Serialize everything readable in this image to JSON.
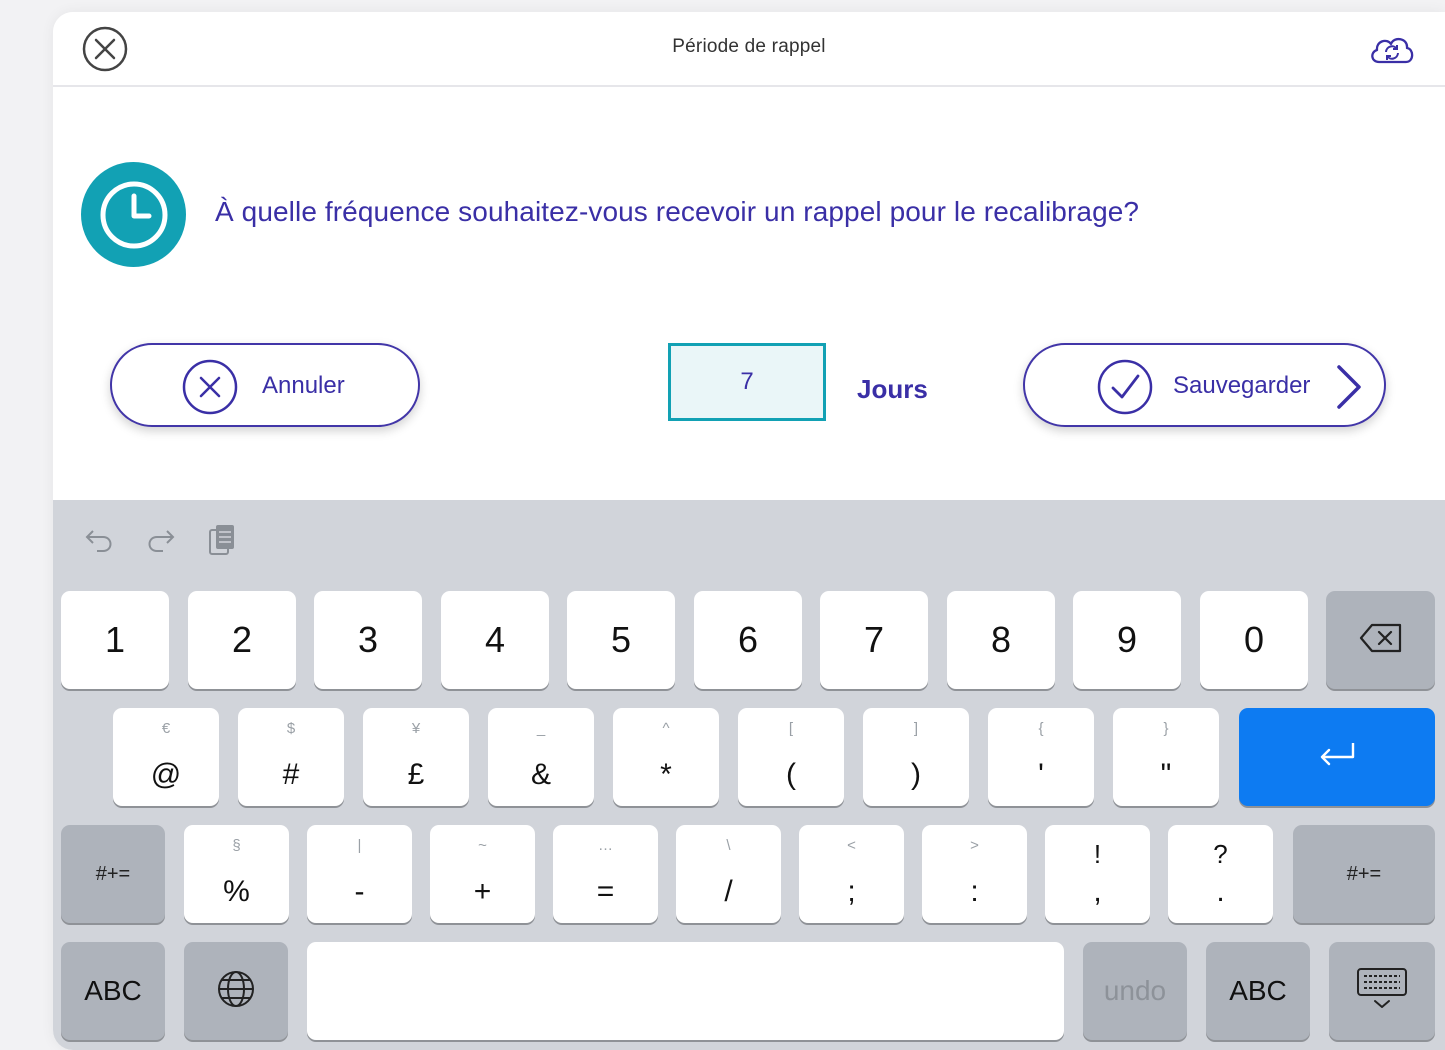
{
  "header": {
    "title": "Période de rappel",
    "close_icon": "close-circle-icon",
    "sync_icon": "cloud-sync-icon"
  },
  "prompt": {
    "icon": "clock-icon",
    "question": "À quelle fréquence souhaitez-vous recevoir un rappel pour le recalibrage?"
  },
  "actions": {
    "cancel_label": "Annuler",
    "save_label": "Sauvegarder"
  },
  "reminder": {
    "value": "7",
    "unit": "Jours"
  },
  "colors": {
    "accent": "#3a2fa6",
    "teal": "#12a1b4",
    "keyboard_bg": "#d1d4da",
    "return_key": "#0d7bf2"
  },
  "keyboard": {
    "toolbar": [
      "undo-arrow-icon",
      "redo-arrow-icon",
      "paste-icon"
    ],
    "row1": [
      "1",
      "2",
      "3",
      "4",
      "5",
      "6",
      "7",
      "8",
      "9",
      "0"
    ],
    "row2": [
      {
        "sec": "€",
        "pri": "@"
      },
      {
        "sec": "$",
        "pri": "#"
      },
      {
        "sec": "¥",
        "pri": "£"
      },
      {
        "sec": "_",
        "pri": "&"
      },
      {
        "sec": "^",
        "pri": "*"
      },
      {
        "sec": "[",
        "pri": "("
      },
      {
        "sec": "]",
        "pri": ")"
      },
      {
        "sec": "{",
        "pri": "'"
      },
      {
        "sec": "}",
        "pri": "\""
      }
    ],
    "row3": [
      {
        "sec": "§",
        "pri": "%"
      },
      {
        "sec": "|",
        "pri": "-"
      },
      {
        "sec": "~",
        "pri": "+"
      },
      {
        "sec": "…",
        "pri": "="
      },
      {
        "sec": "\\",
        "pri": "/"
      },
      {
        "sec": "<",
        "pri": ";"
      },
      {
        "sec": ">",
        "pri": ":"
      },
      {
        "sec": "!",
        "pri": ","
      },
      {
        "sec": "?",
        "pri": "."
      }
    ],
    "shift_label": "#+=",
    "abc_label": "ABC",
    "undo_label": "undo"
  }
}
